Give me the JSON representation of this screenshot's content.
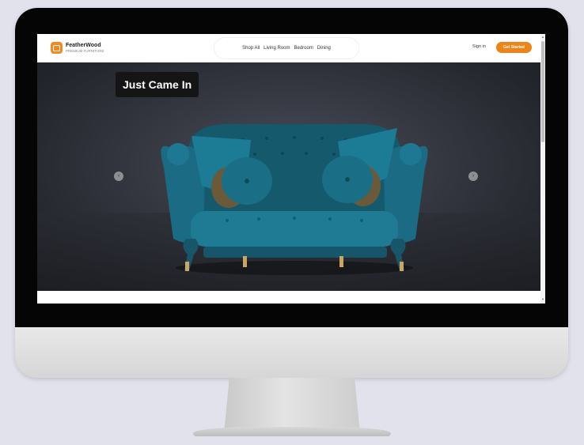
{
  "brand": {
    "name": "FeatherWood",
    "tagline": "PREMIUM FURNITURE"
  },
  "nav": {
    "links": [
      "Shop All",
      "Living Room",
      "Bedroom",
      "Dining"
    ],
    "sign_in": "Sign in",
    "cta": "Get Started"
  },
  "hero": {
    "tag": "Just Came In",
    "prev": "‹",
    "next": "›"
  },
  "scrollbar": {
    "up": "▲",
    "down": "▼"
  },
  "colors": {
    "accent": "#ee8416",
    "sofa": "#1f6e86",
    "hero_bg": "#2b2d34"
  }
}
